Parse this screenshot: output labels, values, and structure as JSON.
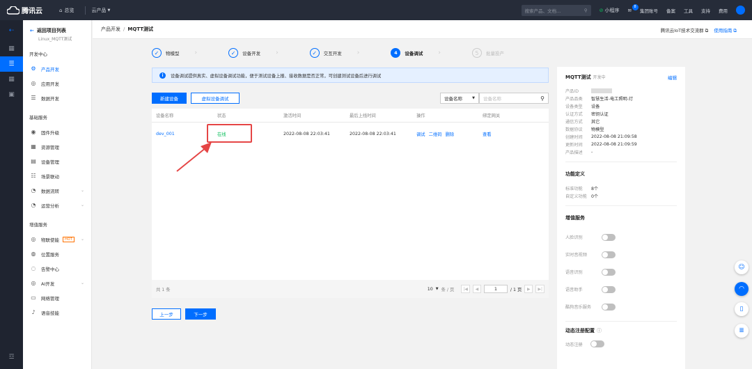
{
  "topbar": {
    "brand": "腾讯云",
    "home": "总览",
    "products": "云产品",
    "search_placeholder": "搜索产品、文档...",
    "miniapp": "小程序",
    "msg_badge": "8",
    "account": "集团账号",
    "billing": "备案",
    "tools": "工具",
    "support": "支持",
    "cost": "费用"
  },
  "iconbar": [
    "⇠",
    "▦",
    "☰",
    "▦",
    "▣",
    "☲"
  ],
  "nav": {
    "back": "返回项目列表",
    "project": "Linux_MQTT测试",
    "sec1": "开发中心",
    "dev_items": [
      {
        "icon": "⚙",
        "label": "产品开发"
      },
      {
        "icon": "◎",
        "label": "应用开发"
      },
      {
        "icon": "☰",
        "label": "数据开发"
      }
    ],
    "sec2": "基础服务",
    "basic_items": [
      {
        "icon": "◉",
        "label": "固件升级"
      },
      {
        "icon": "▦",
        "label": "资源管理"
      },
      {
        "icon": "▤",
        "label": "设备管理"
      },
      {
        "icon": "☷",
        "label": "场景联动"
      },
      {
        "icon": "◔",
        "label": "数据流转"
      },
      {
        "icon": "◔",
        "label": "运营分析"
      }
    ],
    "sec3": "增值服务",
    "hot": "HOT",
    "vas_items": [
      {
        "icon": "◎",
        "label": "物联使能"
      },
      {
        "icon": "◍",
        "label": "位置服务"
      },
      {
        "icon": "◌",
        "label": "告警中心"
      },
      {
        "icon": "◎",
        "label": "AI开发"
      },
      {
        "icon": "▭",
        "label": "网络管理"
      },
      {
        "icon": "♪",
        "label": "语音技能"
      }
    ]
  },
  "crumb": {
    "parent": "产品开发",
    "sep": "/",
    "current": "MQTT测试",
    "forum": "腾讯云IoT技术交流群",
    "guide": "使用指南"
  },
  "steps": [
    {
      "num": "✓",
      "label": "物模型"
    },
    {
      "num": "✓",
      "label": "设备开发"
    },
    {
      "num": "✓",
      "label": "交互开发"
    },
    {
      "num": "4",
      "label": "设备调试"
    },
    {
      "num": "5",
      "label": "批量投产"
    }
  ],
  "info": "设备调试提供真实、虚拟设备调试功能，便于测试设备上报、接收数据是否正常，可创建测试设备后进行调试",
  "toolbar": {
    "new_device": "新建设备",
    "virtual_debug": "虚拟设备调试",
    "filter": "设备名称",
    "search_placeholder": "设备名称"
  },
  "table": {
    "headers": [
      "设备名称",
      "状态",
      "激活时间",
      "最后上线时间",
      "操作",
      "绑定网关"
    ],
    "rows": [
      {
        "name": "dev_001",
        "status": "在线",
        "activated": "2022-08-08 22:03:41",
        "last_online": "2022-08-08 22:03:41",
        "op_debug": "调试",
        "op_qr": "二维码",
        "op_del": "删除",
        "gateway": "查看"
      }
    ]
  },
  "pager": {
    "total": "共 1 条",
    "page_size": "10",
    "per_page": "条 / 页",
    "first": "|◀",
    "prev": "◀",
    "page": "1",
    "pages": "/ 1 页",
    "next": "▶",
    "last": "▶|"
  },
  "footer": {
    "prev": "上一步",
    "next": "下一步"
  },
  "panel": {
    "title": "MQTT测试",
    "state": "开发中",
    "edit": "编辑",
    "fields": [
      {
        "k": "产品ID",
        "v": ""
      },
      {
        "k": "产品品类",
        "v": "智慧生活-电工照明-灯"
      },
      {
        "k": "设备类型",
        "v": "设备"
      },
      {
        "k": "认证方式",
        "v": "密钥认证"
      },
      {
        "k": "通信方式",
        "v": "其它"
      },
      {
        "k": "数据协议",
        "v": "物模型"
      },
      {
        "k": "创建时间",
        "v": "2022-08-08 21:09:58"
      },
      {
        "k": "更新时间",
        "v": "2022-08-08 21:09:59"
      },
      {
        "k": "产品描述",
        "v": "-"
      }
    ],
    "func_title": "功能定义",
    "func": [
      {
        "k": "标准功能",
        "v": "8个"
      },
      {
        "k": "自定义功能",
        "v": "0个"
      }
    ],
    "vas_title": "增值服务",
    "services": [
      "人脸识别",
      "实时音视频",
      "语音识别",
      "语音助手",
      "酷狗音乐服务"
    ],
    "dyn_title": "动态注册配置",
    "dyn_item": "动态注册"
  },
  "colors": {
    "primary": "#006eff",
    "online": "#0abf5b",
    "highlight": "#e54545"
  }
}
